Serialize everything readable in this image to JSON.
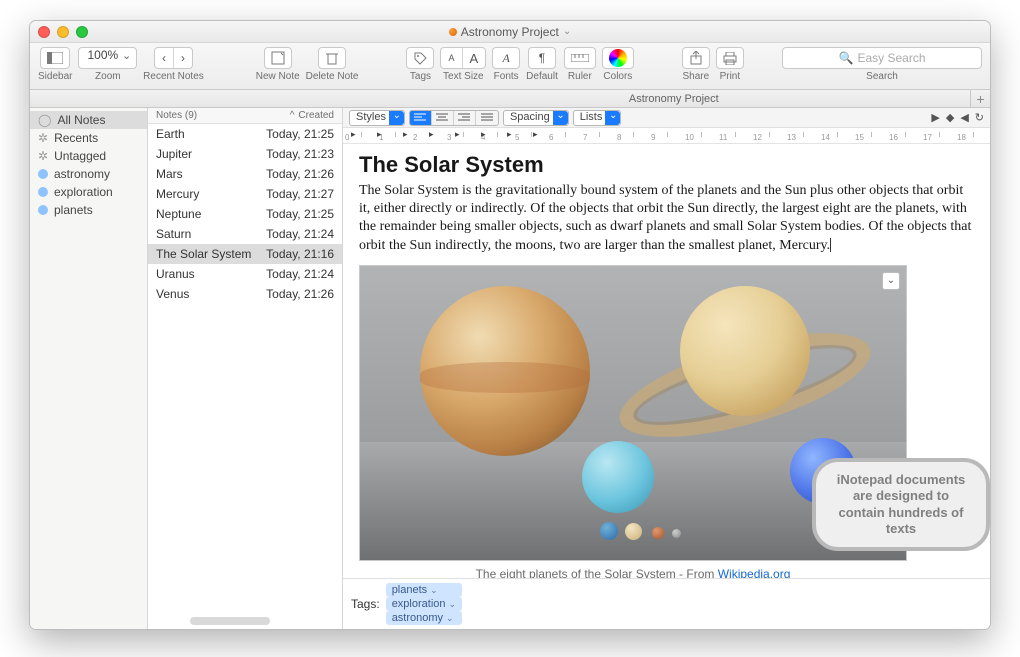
{
  "window": {
    "title": "Astronomy Project"
  },
  "toolbar": {
    "sidebar": "Sidebar",
    "zoom_label": "Zoom",
    "zoom_value": "100%",
    "recent": "Recent Notes",
    "newnote": "New Note",
    "delnote": "Delete Note",
    "tags": "Tags",
    "textsize": "Text Size",
    "fonts": "Fonts",
    "default": "Default",
    "ruler": "Ruler",
    "colors": "Colors",
    "share": "Share",
    "print": "Print",
    "search_label": "Search",
    "search_placeholder": "Easy Search"
  },
  "subheader": {
    "title": "Astronomy Project"
  },
  "sidebar": {
    "items": [
      {
        "label": "All Notes",
        "builtin": true,
        "selected": true
      },
      {
        "label": "Recents",
        "builtin": true
      },
      {
        "label": "Untagged",
        "builtin": true
      },
      {
        "label": "astronomy",
        "color": "#8fc3ff"
      },
      {
        "label": "exploration",
        "color": "#8fc3ff"
      },
      {
        "label": "planets",
        "color": "#8fc3ff"
      }
    ]
  },
  "noteslist": {
    "header_notes": "Notes (9)",
    "header_created": "Created",
    "rows": [
      {
        "title": "Earth",
        "created": "Today, 21:25"
      },
      {
        "title": "Jupiter",
        "created": "Today, 21:23"
      },
      {
        "title": "Mars",
        "created": "Today, 21:26"
      },
      {
        "title": "Mercury",
        "created": "Today, 21:27"
      },
      {
        "title": "Neptune",
        "created": "Today, 21:25"
      },
      {
        "title": "Saturn",
        "created": "Today, 21:24"
      },
      {
        "title": "The Solar System",
        "created": "Today, 21:16",
        "selected": true
      },
      {
        "title": "Uranus",
        "created": "Today, 21:24"
      },
      {
        "title": "Venus",
        "created": "Today, 21:26"
      }
    ]
  },
  "editor": {
    "styles": "Styles",
    "spacing": "Spacing",
    "lists": "Lists",
    "heading": "The Solar System",
    "body": "The Solar System is the gravitationally bound system of the planets and the Sun plus other objects that orbit it, either directly or indirectly. Of the objects that orbit the Sun directly, the largest eight are the planets, with the remainder being smaller objects, such as dwarf planets and small Solar System bodies. Of the objects that orbit the Sun indirectly, the moons, two are larger than the smallest planet, Mercury.",
    "caption_prefix": "The eight planets of the Solar System - From ",
    "caption_link": "Wikipedia.org",
    "tags_label": "Tags:",
    "tags": [
      "planets",
      "exploration",
      "astronomy"
    ]
  },
  "callout": "iNotepad documents are designed to contain hundreds of texts"
}
